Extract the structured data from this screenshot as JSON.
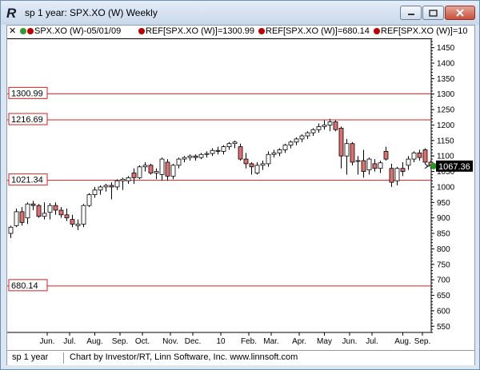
{
  "window": {
    "title": "sp 1 year: SPX.XO (W) Weekly",
    "icon": "rt-logo-icon"
  },
  "legend": {
    "close_mark": "✕",
    "items": [
      {
        "label": "SPX.XO (W)-05/01/09",
        "dots": [
          "#2d9b2d",
          "#c00000"
        ]
      },
      {
        "label": "REF[SPX.XO (W)]=1300.99",
        "dots": [
          "#c00000"
        ]
      },
      {
        "label": "REF[SPX.XO (W)]=680.14",
        "dots": [
          "#c00000"
        ]
      },
      {
        "label": "REF[SPX.XO (W)]=10",
        "dots": [
          "#c00000"
        ]
      }
    ]
  },
  "status": {
    "left": "sp 1 year",
    "credit": "Chart by Investor/RT, Linn Software, Inc. www.linnsoft.com"
  },
  "colors": {
    "ref_line": "#d02020",
    "down_candle": "#e07070",
    "up_candle": "#ffffff",
    "last_price_bg": "#000000",
    "last_price_marker": "#1e9e1e"
  },
  "chart_data": {
    "type": "candlestick",
    "symbol": "SPX.XO (W)",
    "period": "Weekly",
    "ylim": [
      530,
      1480
    ],
    "y_ticks": [
      550,
      600,
      650,
      700,
      750,
      800,
      850,
      900,
      950,
      1000,
      1050,
      1100,
      1150,
      1200,
      1250,
      1300,
      1350,
      1400,
      1450
    ],
    "x_month_labels": [
      "Jun.",
      "Jul.",
      "Aug.",
      "Sep.",
      "Oct.",
      "Nov.",
      "Dec.",
      "10",
      "Feb.",
      "Mar.",
      "Apr.",
      "May",
      "Jun.",
      "Jul.",
      "Aug.",
      "Sep."
    ],
    "x_month_label_week_index": [
      6.5,
      10.5,
      15,
      19.5,
      23.5,
      28.5,
      32.5,
      37.5,
      42.5,
      46.5,
      51.5,
      56,
      60.5,
      64.5,
      70,
      73.5
    ],
    "reference_lines": [
      {
        "label": "1300.99",
        "value": 1300.99
      },
      {
        "label": "1216.69",
        "value": 1216.69
      },
      {
        "label": "1021.34",
        "value": 1021.34
      },
      {
        "label": "680.14",
        "value": 680.14
      }
    ],
    "last_price": {
      "label": "1067.36",
      "value": 1067.36
    },
    "candles": [
      {
        "o": 850,
        "h": 875,
        "l": 835,
        "c": 870
      },
      {
        "o": 875,
        "h": 930,
        "l": 870,
        "c": 920
      },
      {
        "o": 920,
        "h": 935,
        "l": 875,
        "c": 885
      },
      {
        "o": 900,
        "h": 950,
        "l": 880,
        "c": 945
      },
      {
        "o": 945,
        "h": 955,
        "l": 925,
        "c": 940
      },
      {
        "o": 940,
        "h": 945,
        "l": 900,
        "c": 905
      },
      {
        "o": 905,
        "h": 950,
        "l": 895,
        "c": 915
      },
      {
        "o": 918,
        "h": 948,
        "l": 895,
        "c": 940
      },
      {
        "o": 940,
        "h": 950,
        "l": 910,
        "c": 925
      },
      {
        "o": 925,
        "h": 935,
        "l": 900,
        "c": 910
      },
      {
        "o": 910,
        "h": 930,
        "l": 890,
        "c": 900
      },
      {
        "o": 895,
        "h": 910,
        "l": 870,
        "c": 880
      },
      {
        "o": 875,
        "h": 895,
        "l": 860,
        "c": 880
      },
      {
        "o": 880,
        "h": 945,
        "l": 870,
        "c": 940
      },
      {
        "o": 940,
        "h": 980,
        "l": 935,
        "c": 975
      },
      {
        "o": 975,
        "h": 1000,
        "l": 965,
        "c": 990
      },
      {
        "o": 990,
        "h": 1005,
        "l": 975,
        "c": 1000
      },
      {
        "o": 1000,
        "h": 1010,
        "l": 985,
        "c": 1005
      },
      {
        "o": 1005,
        "h": 1015,
        "l": 960,
        "c": 1000
      },
      {
        "o": 1000,
        "h": 1025,
        "l": 990,
        "c": 1020
      },
      {
        "o": 1020,
        "h": 1030,
        "l": 990,
        "c": 1025
      },
      {
        "o": 1020,
        "h": 1035,
        "l": 1010,
        "c": 1030
      },
      {
        "o": 1045,
        "h": 1060,
        "l": 1010,
        "c": 1030
      },
      {
        "o": 1030,
        "h": 1070,
        "l": 1025,
        "c": 1065
      },
      {
        "o": 1065,
        "h": 1080,
        "l": 1050,
        "c": 1070
      },
      {
        "o": 1070,
        "h": 1075,
        "l": 1040,
        "c": 1045
      },
      {
        "o": 1045,
        "h": 1060,
        "l": 1025,
        "c": 1050
      },
      {
        "o": 1040,
        "h": 1095,
        "l": 1020,
        "c": 1090
      },
      {
        "o": 1080,
        "h": 1090,
        "l": 1020,
        "c": 1035
      },
      {
        "o": 1035,
        "h": 1075,
        "l": 1025,
        "c": 1070
      },
      {
        "o": 1070,
        "h": 1095,
        "l": 1060,
        "c": 1090
      },
      {
        "o": 1090,
        "h": 1100,
        "l": 1080,
        "c": 1095
      },
      {
        "o": 1095,
        "h": 1105,
        "l": 1085,
        "c": 1100
      },
      {
        "o": 1100,
        "h": 1105,
        "l": 1085,
        "c": 1095
      },
      {
        "o": 1095,
        "h": 1110,
        "l": 1090,
        "c": 1105
      },
      {
        "o": 1105,
        "h": 1115,
        "l": 1095,
        "c": 1108
      },
      {
        "o": 1108,
        "h": 1125,
        "l": 1100,
        "c": 1118
      },
      {
        "o": 1118,
        "h": 1130,
        "l": 1105,
        "c": 1115
      },
      {
        "o": 1115,
        "h": 1135,
        "l": 1105,
        "c": 1130
      },
      {
        "o": 1130,
        "h": 1145,
        "l": 1120,
        "c": 1140
      },
      {
        "o": 1140,
        "h": 1150,
        "l": 1125,
        "c": 1145
      },
      {
        "o": 1130,
        "h": 1140,
        "l": 1085,
        "c": 1090
      },
      {
        "o": 1090,
        "h": 1110,
        "l": 1060,
        "c": 1075
      },
      {
        "o": 1075,
        "h": 1080,
        "l": 1040,
        "c": 1065
      },
      {
        "o": 1045,
        "h": 1080,
        "l": 1040,
        "c": 1070
      },
      {
        "o": 1070,
        "h": 1085,
        "l": 1055,
        "c": 1075
      },
      {
        "o": 1075,
        "h": 1115,
        "l": 1065,
        "c": 1105
      },
      {
        "o": 1105,
        "h": 1120,
        "l": 1095,
        "c": 1110
      },
      {
        "o": 1110,
        "h": 1125,
        "l": 1100,
        "c": 1120
      },
      {
        "o": 1120,
        "h": 1140,
        "l": 1110,
        "c": 1135
      },
      {
        "o": 1135,
        "h": 1150,
        "l": 1125,
        "c": 1145
      },
      {
        "o": 1145,
        "h": 1160,
        "l": 1135,
        "c": 1155
      },
      {
        "o": 1155,
        "h": 1170,
        "l": 1145,
        "c": 1165
      },
      {
        "o": 1165,
        "h": 1180,
        "l": 1155,
        "c": 1175
      },
      {
        "o": 1175,
        "h": 1190,
        "l": 1165,
        "c": 1185
      },
      {
        "o": 1185,
        "h": 1205,
        "l": 1175,
        "c": 1195
      },
      {
        "o": 1195,
        "h": 1215,
        "l": 1185,
        "c": 1200
      },
      {
        "o": 1200,
        "h": 1220,
        "l": 1180,
        "c": 1210
      },
      {
        "o": 1210,
        "h": 1215,
        "l": 1180,
        "c": 1185
      },
      {
        "o": 1190,
        "h": 1195,
        "l": 1060,
        "c": 1100
      },
      {
        "o": 1100,
        "h": 1155,
        "l": 1040,
        "c": 1140
      },
      {
        "o": 1140,
        "h": 1145,
        "l": 1070,
        "c": 1080
      },
      {
        "o": 1085,
        "h": 1100,
        "l": 1040,
        "c": 1085
      },
      {
        "o": 1085,
        "h": 1120,
        "l": 1030,
        "c": 1050
      },
      {
        "o": 1055,
        "h": 1095,
        "l": 1040,
        "c": 1090
      },
      {
        "o": 1075,
        "h": 1090,
        "l": 1050,
        "c": 1060
      },
      {
        "o": 1060,
        "h": 1085,
        "l": 1045,
        "c": 1078
      },
      {
        "o": 1115,
        "h": 1130,
        "l": 1085,
        "c": 1090
      },
      {
        "o": 1060,
        "h": 1075,
        "l": 1000,
        "c": 1015
      },
      {
        "o": 1020,
        "h": 1065,
        "l": 1005,
        "c": 1060
      },
      {
        "o": 1060,
        "h": 1080,
        "l": 1035,
        "c": 1050
      },
      {
        "o": 1070,
        "h": 1100,
        "l": 1055,
        "c": 1090
      },
      {
        "o": 1090,
        "h": 1115,
        "l": 1080,
        "c": 1110
      },
      {
        "o": 1110,
        "h": 1120,
        "l": 1085,
        "c": 1095
      },
      {
        "o": 1120,
        "h": 1125,
        "l": 1075,
        "c": 1080
      },
      {
        "o": 1080,
        "h": 1085,
        "l": 1060,
        "c": 1070
      },
      {
        "o": 1072,
        "h": 1080,
        "l": 1060,
        "c": 1067
      }
    ]
  }
}
